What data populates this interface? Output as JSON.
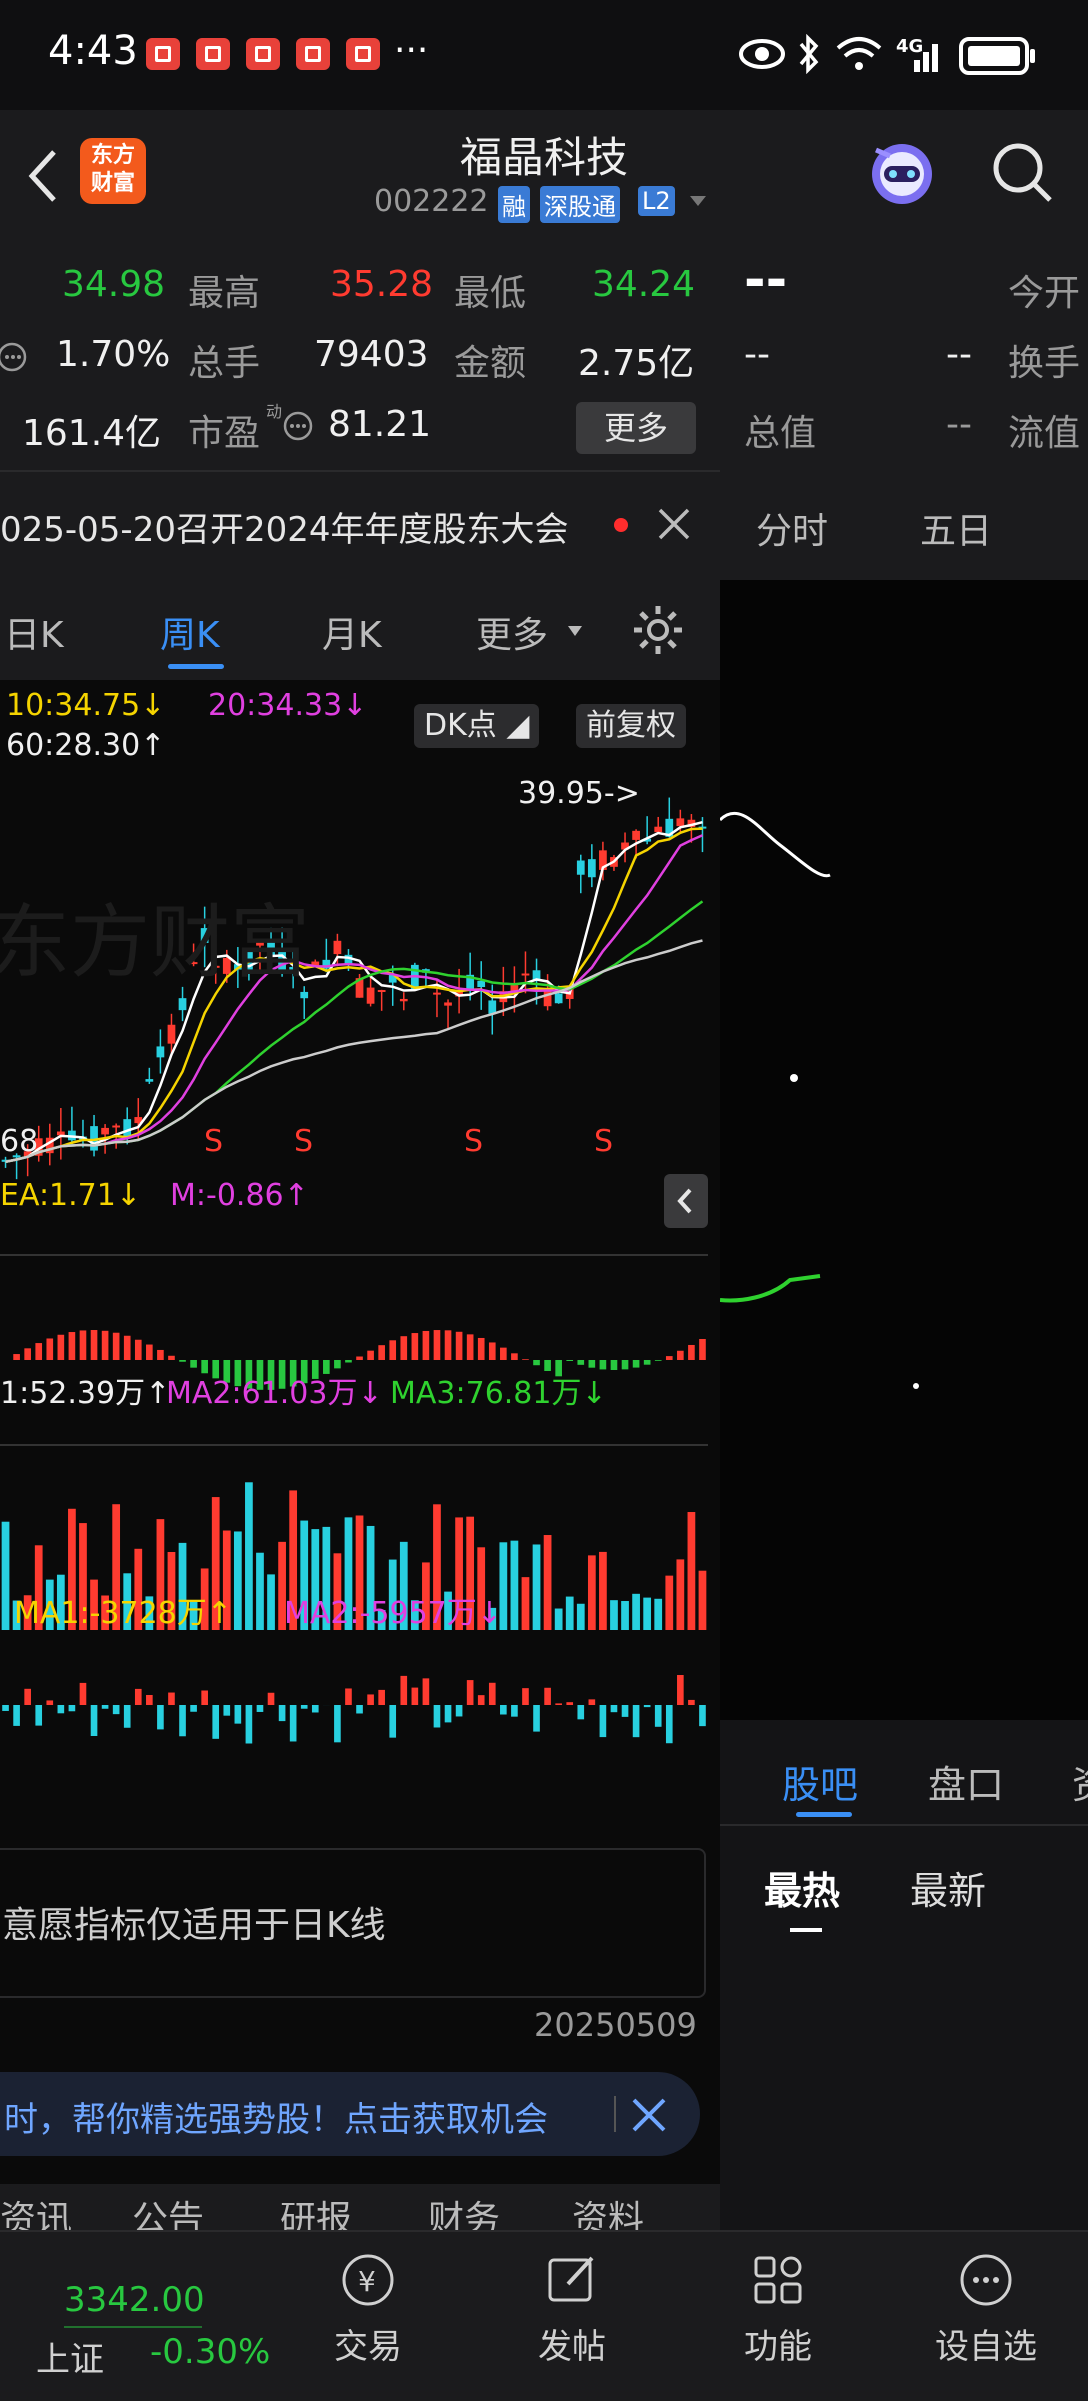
{
  "status": {
    "time": "4:43",
    "dots": "···",
    "network": "4G"
  },
  "header": {
    "back_icon": "chevron-left-icon",
    "logo_text_1": "东方",
    "logo_text_2": "财富",
    "stock_name": "福晶科技",
    "stock_code": "002222",
    "tag_rong": "融",
    "tag_sgt": "深股通",
    "tag_l2": "L2"
  },
  "quote": {
    "row1": {
      "v1": "34.98",
      "label_high": "最高",
      "high": "35.28",
      "label_low": "最低",
      "low": "34.24"
    },
    "row2": {
      "v1": "1.70%",
      "label_vol": "总手",
      "vol": "79403",
      "label_amt": "金额",
      "amt": "2.75亿"
    },
    "row3": {
      "v1": "161.4亿",
      "label_pe": "市盈",
      "pe_sup": "动",
      "pe": "81.21",
      "more": "更多"
    },
    "right": {
      "price": "--",
      "open_label": "今开",
      "r2a": "--",
      "r2b": "--",
      "turnover_label": "换手",
      "total_label": "总值",
      "total": "--",
      "float_label": "流值"
    }
  },
  "notice": {
    "text": "025-05-20召开2024年年度股东大会"
  },
  "right_tabs": [
    "分时",
    "五日"
  ],
  "ktabs": {
    "day": "日K",
    "week": "周K",
    "month": "月K",
    "more": "更多"
  },
  "ma": {
    "ma10": "10:34.75↓",
    "ma20": "20:34.33↓",
    "ma60": "60:28.30↑",
    "dk": "DK点",
    "fq": "前复权",
    "peak": "39.95->",
    "low_label": "68",
    "s_marks": [
      "S",
      "S",
      "S",
      "S"
    ]
  },
  "macd": {
    "dea": "EA:1.71↓",
    "m": "M:-0.86↑"
  },
  "vol": {
    "ma1": "1:52.39万↑",
    "ma2": "MA2:61.03万↓",
    "ma3": "MA3:76.81万↓"
  },
  "flow": {
    "ma1": "MA1:-3728万↑",
    "ma2": "MA2:-5957万↓"
  },
  "willing": {
    "text": "意愿指标仅适用于日K线"
  },
  "date_label": "20250509",
  "promo": {
    "text": "时，帮你精选强势股！点击获取机会"
  },
  "bottom_tabs_partial": [
    "资讯",
    "公告",
    "研报",
    "财务",
    "资料"
  ],
  "right_bottom": {
    "tab1": "股吧",
    "tab2": "盘口",
    "tab3": "资",
    "sort_hot": "最热",
    "sort_new": "最新"
  },
  "bottombar": {
    "index_value": "3342.00",
    "index_name": "上证",
    "index_change": "-0.30%",
    "trade": "交易",
    "post": "发帖",
    "func": "功能",
    "watch": "设自选"
  },
  "colors": {
    "up": "#ff3b30",
    "down": "#28c840",
    "accent": "#2f8ff0",
    "ma5": "#ffffff",
    "ma10": "#f5d400",
    "ma20": "#e040e0",
    "ma60": "#2fd22f"
  }
}
